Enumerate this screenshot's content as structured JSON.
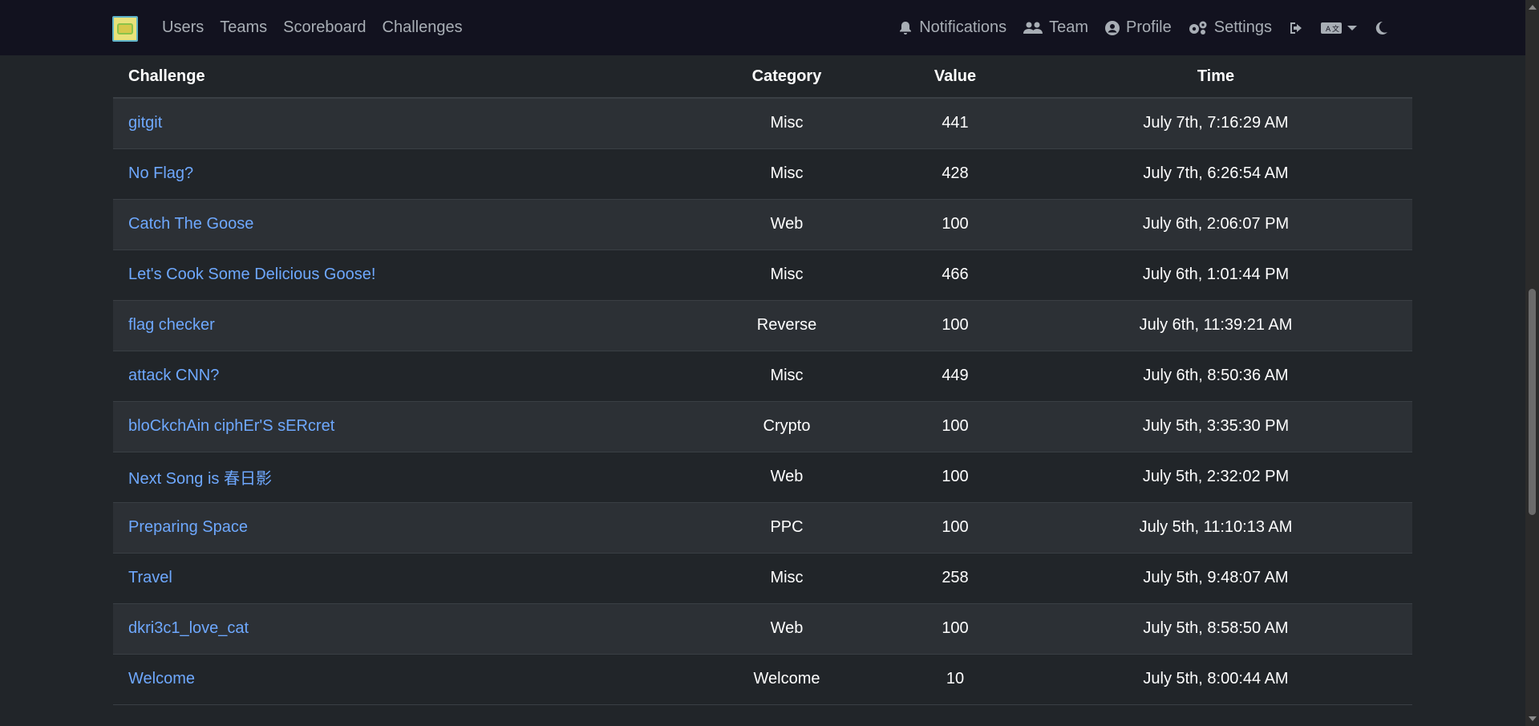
{
  "nav": {
    "left": [
      {
        "label": "Users"
      },
      {
        "label": "Teams"
      },
      {
        "label": "Scoreboard"
      },
      {
        "label": "Challenges"
      }
    ],
    "right": [
      {
        "label": "Notifications",
        "icon": "bell-icon"
      },
      {
        "label": "Team",
        "icon": "users-icon"
      },
      {
        "label": "Profile",
        "icon": "user-circle-icon"
      },
      {
        "label": "Settings",
        "icon": "gears-icon"
      }
    ],
    "logout_icon": "sign-out-icon",
    "language_icon": "language-icon",
    "theme_icon": "moon-icon"
  },
  "table": {
    "headers": {
      "challenge": "Challenge",
      "category": "Category",
      "value": "Value",
      "time": "Time"
    },
    "rows": [
      {
        "challenge": "gitgit",
        "category": "Misc",
        "value": "441",
        "time": "July 7th, 7:16:29 AM"
      },
      {
        "challenge": "No Flag?",
        "category": "Misc",
        "value": "428",
        "time": "July 7th, 6:26:54 AM"
      },
      {
        "challenge": "Catch The Goose",
        "category": "Web",
        "value": "100",
        "time": "July 6th, 2:06:07 PM"
      },
      {
        "challenge": "Let's Cook Some Delicious Goose!",
        "category": "Misc",
        "value": "466",
        "time": "July 6th, 1:01:44 PM"
      },
      {
        "challenge": "flag checker",
        "category": "Reverse",
        "value": "100",
        "time": "July 6th, 11:39:21 AM"
      },
      {
        "challenge": "attack CNN?",
        "category": "Misc",
        "value": "449",
        "time": "July 6th, 8:50:36 AM"
      },
      {
        "challenge": "bloCkchAin ciphEr'S sERcret",
        "category": "Crypto",
        "value": "100",
        "time": "July 5th, 3:35:30 PM"
      },
      {
        "challenge": "Next Song is 春日影",
        "category": "Web",
        "value": "100",
        "time": "July 5th, 2:32:02 PM"
      },
      {
        "challenge": "Preparing Space",
        "category": "PPC",
        "value": "100",
        "time": "July 5th, 11:10:13 AM"
      },
      {
        "challenge": "Travel",
        "category": "Misc",
        "value": "258",
        "time": "July 5th, 9:48:07 AM"
      },
      {
        "challenge": "dkri3c1_love_cat",
        "category": "Web",
        "value": "100",
        "time": "July 5th, 8:58:50 AM"
      },
      {
        "challenge": "Welcome",
        "category": "Welcome",
        "value": "10",
        "time": "July 5th, 8:00:44 AM"
      }
    ]
  },
  "colors": {
    "link": "#6ea8fe",
    "navbar": "#12121f",
    "background": "#212529",
    "row_alt": "#2c3035"
  }
}
